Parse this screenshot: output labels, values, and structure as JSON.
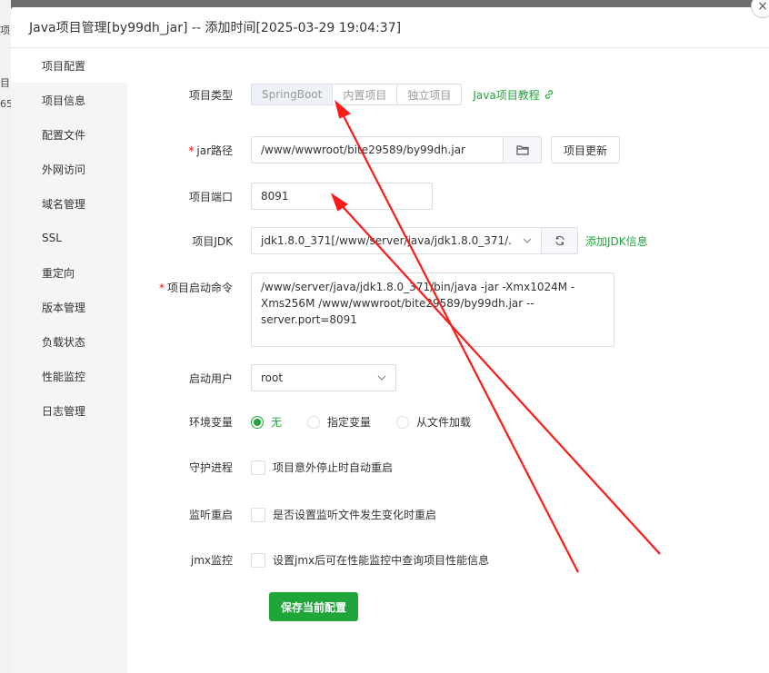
{
  "background": {
    "strip_texts": [
      "项",
      "目",
      "65"
    ]
  },
  "dialog": {
    "title": "Java项目管理[by99dh_jar] -- 添加时间[2025-03-29 19:04:37]",
    "close_symbol": "×"
  },
  "sidebar": {
    "items": [
      {
        "label": "项目配置"
      },
      {
        "label": "项目信息"
      },
      {
        "label": "配置文件"
      },
      {
        "label": "外网访问"
      },
      {
        "label": "域名管理"
      },
      {
        "label": "SSL"
      },
      {
        "label": "重定向"
      },
      {
        "label": "版本管理"
      },
      {
        "label": "负载状态"
      },
      {
        "label": "性能监控"
      },
      {
        "label": "日志管理"
      }
    ]
  },
  "form": {
    "project_type": {
      "label": "项目类型",
      "options": [
        "SpringBoot",
        "内置项目",
        "独立项目"
      ],
      "selected": "SpringBoot",
      "tutorial_link": "Java项目教程"
    },
    "jar_path": {
      "required_mark": "*",
      "label": "jar路径",
      "value": "/www/wwwroot/bite29589/by99dh.jar",
      "update_button": "项目更新"
    },
    "port": {
      "label": "项目端口",
      "value": "8091"
    },
    "jdk": {
      "label": "项目JDK",
      "value": "jdk1.8.0_371[/www/server/java/jdk1.8.0_371/...",
      "add_link": "添加JDK信息"
    },
    "start_command": {
      "required_mark": "*",
      "label": "项目启动命令",
      "value": "/www/server/java/jdk1.8.0_371/bin/java -jar  -Xmx1024M -Xms256M /www/wwwroot/bite29589/by99dh.jar --server.port=8091"
    },
    "user": {
      "label": "启动用户",
      "value": "root"
    },
    "env": {
      "label": "环境变量",
      "options": [
        "无",
        "指定变量",
        "从文件加载"
      ],
      "selected": "无"
    },
    "daemon": {
      "label": "守护进程",
      "text": "项目意外停止时自动重启",
      "checked": false
    },
    "watch": {
      "label": "监听重启",
      "text": "是否设置监听文件发生变化时重启",
      "checked": false
    },
    "jmx": {
      "label": "jmx监控",
      "text": "设置jmx后可在性能监控中查询项目性能信息",
      "checked": false
    },
    "save_button": "保存当前配置"
  },
  "colors": {
    "accent": "#20a53a",
    "required": "#ef0808",
    "arrow": "#ff1a1a"
  }
}
